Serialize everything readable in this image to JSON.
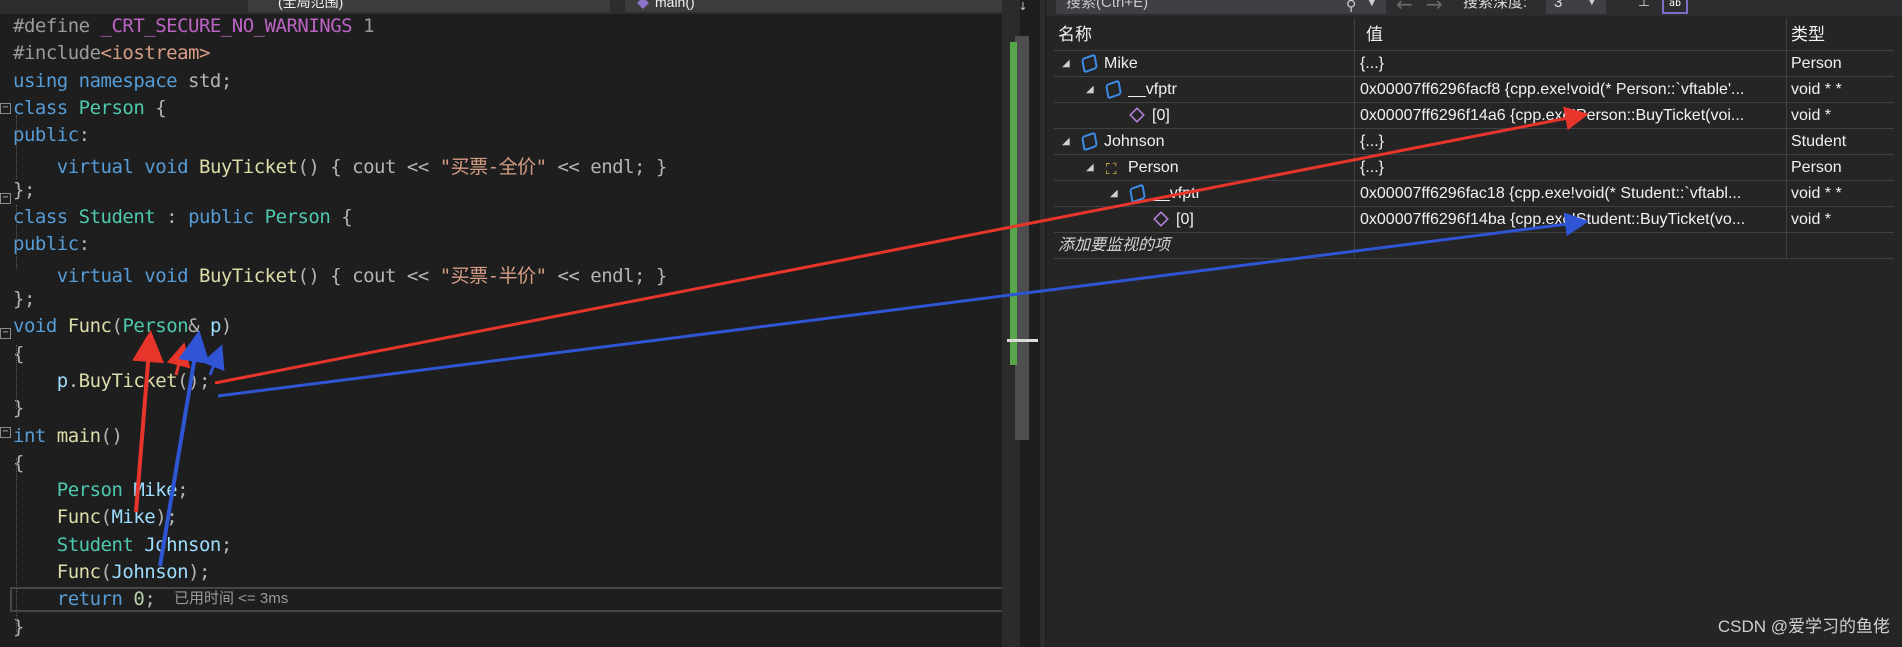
{
  "editor": {
    "tab_scope": "(全局范围)",
    "tab_function": "main()",
    "elapsed": "已用时间 <= 3ms"
  },
  "code": [
    {
      "tokens": [
        {
          "t": "#define ",
          "c": "pp"
        },
        {
          "t": "_CRT_SECURE_NO_WARNINGS",
          "c": "macro"
        },
        {
          "t": " 1",
          "c": "pp"
        }
      ]
    },
    {
      "tokens": [
        {
          "t": "#include",
          "c": "pp"
        },
        {
          "t": "<iostream>",
          "c": "str"
        }
      ]
    },
    {
      "tokens": [
        {
          "t": "using",
          "c": "kw"
        },
        {
          "t": " ",
          "c": "pun"
        },
        {
          "t": "namespace",
          "c": "kw"
        },
        {
          "t": " std;",
          "c": "pun"
        }
      ]
    },
    {
      "tokens": [
        {
          "t": "class",
          "c": "kw"
        },
        {
          "t": " ",
          "c": "pun"
        },
        {
          "t": "Person",
          "c": "type"
        },
        {
          "t": " {",
          "c": "pun"
        }
      ]
    },
    {
      "tokens": [
        {
          "t": "public",
          "c": "kw"
        },
        {
          "t": ":",
          "c": "pun"
        }
      ]
    },
    {
      "tokens": [
        {
          "t": "    ",
          "c": "pun"
        },
        {
          "t": "virtual",
          "c": "kw"
        },
        {
          "t": " ",
          "c": "pun"
        },
        {
          "t": "void",
          "c": "kw"
        },
        {
          "t": " ",
          "c": "pun"
        },
        {
          "t": "BuyTicket",
          "c": "fn"
        },
        {
          "t": "() { cout << ",
          "c": "pun"
        },
        {
          "t": "\"买票-全价\"",
          "c": "str"
        },
        {
          "t": " << endl; }",
          "c": "pun"
        }
      ]
    },
    {
      "tokens": [
        {
          "t": "};",
          "c": "pun"
        }
      ]
    },
    {
      "tokens": [
        {
          "t": "class",
          "c": "kw"
        },
        {
          "t": " ",
          "c": "pun"
        },
        {
          "t": "Student",
          "c": "type"
        },
        {
          "t": " : ",
          "c": "pun"
        },
        {
          "t": "public",
          "c": "kw"
        },
        {
          "t": " ",
          "c": "pun"
        },
        {
          "t": "Person",
          "c": "type"
        },
        {
          "t": " {",
          "c": "pun"
        }
      ]
    },
    {
      "tokens": [
        {
          "t": "public",
          "c": "kw"
        },
        {
          "t": ":",
          "c": "pun"
        }
      ]
    },
    {
      "tokens": [
        {
          "t": "    ",
          "c": "pun"
        },
        {
          "t": "virtual",
          "c": "kw"
        },
        {
          "t": " ",
          "c": "pun"
        },
        {
          "t": "void",
          "c": "kw"
        },
        {
          "t": " ",
          "c": "pun"
        },
        {
          "t": "BuyTicket",
          "c": "fn"
        },
        {
          "t": "() { cout << ",
          "c": "pun"
        },
        {
          "t": "\"买票-半价\"",
          "c": "str"
        },
        {
          "t": " << endl; }",
          "c": "pun"
        }
      ]
    },
    {
      "tokens": [
        {
          "t": "};",
          "c": "pun"
        }
      ]
    },
    {
      "tokens": [
        {
          "t": "void",
          "c": "kw"
        },
        {
          "t": " ",
          "c": "pun"
        },
        {
          "t": "Func",
          "c": "fn"
        },
        {
          "t": "(",
          "c": "pun"
        },
        {
          "t": "Person",
          "c": "type"
        },
        {
          "t": "& ",
          "c": "pun"
        },
        {
          "t": "p",
          "c": "var"
        },
        {
          "t": ")",
          "c": "pun"
        }
      ]
    },
    {
      "tokens": [
        {
          "t": "{",
          "c": "pun"
        }
      ]
    },
    {
      "tokens": [
        {
          "t": "    ",
          "c": "pun"
        },
        {
          "t": "p",
          "c": "var"
        },
        {
          "t": ".",
          "c": "pun"
        },
        {
          "t": "BuyTicket",
          "c": "fn"
        },
        {
          "t": "();",
          "c": "pun"
        }
      ]
    },
    {
      "tokens": [
        {
          "t": "}",
          "c": "pun"
        }
      ]
    },
    {
      "tokens": [
        {
          "t": "int",
          "c": "kw"
        },
        {
          "t": " ",
          "c": "pun"
        },
        {
          "t": "main",
          "c": "fn"
        },
        {
          "t": "()",
          "c": "pun"
        }
      ]
    },
    {
      "tokens": [
        {
          "t": "{",
          "c": "pun"
        }
      ]
    },
    {
      "tokens": [
        {
          "t": "    ",
          "c": "pun"
        },
        {
          "t": "Person",
          "c": "type"
        },
        {
          "t": " ",
          "c": "pun"
        },
        {
          "t": "Mike",
          "c": "var"
        },
        {
          "t": ";",
          "c": "pun"
        }
      ]
    },
    {
      "tokens": [
        {
          "t": "    ",
          "c": "pun"
        },
        {
          "t": "Func",
          "c": "fn"
        },
        {
          "t": "(",
          "c": "pun"
        },
        {
          "t": "Mike",
          "c": "var"
        },
        {
          "t": ");",
          "c": "pun"
        }
      ]
    },
    {
      "tokens": [
        {
          "t": "    ",
          "c": "pun"
        },
        {
          "t": "Student",
          "c": "type"
        },
        {
          "t": " ",
          "c": "pun"
        },
        {
          "t": "Johnson",
          "c": "var"
        },
        {
          "t": ";",
          "c": "pun"
        }
      ]
    },
    {
      "tokens": [
        {
          "t": "    ",
          "c": "pun"
        },
        {
          "t": "Func",
          "c": "fn"
        },
        {
          "t": "(",
          "c": "pun"
        },
        {
          "t": "Johnson",
          "c": "var"
        },
        {
          "t": ");",
          "c": "pun"
        }
      ]
    },
    {
      "tokens": [
        {
          "t": "    ",
          "c": "pun"
        },
        {
          "t": "return",
          "c": "kw"
        },
        {
          "t": " ",
          "c": "pun"
        },
        {
          "t": "0",
          "c": "num"
        },
        {
          "t": ";",
          "c": "pun"
        }
      ]
    },
    {
      "tokens": [
        {
          "t": "}",
          "c": "pun"
        }
      ]
    }
  ],
  "watch": {
    "search_placeholder": "搜索(Ctrl+E)",
    "depth_label": "搜索深度:",
    "depth_value": "3",
    "hex_label": "ab",
    "columns": {
      "name": "名称",
      "value": "值",
      "type": "类型"
    },
    "rows": [
      {
        "name": "Mike",
        "value": "{...}",
        "type": "Person",
        "icon": "object-icon"
      },
      {
        "name": "__vfptr",
        "value": "0x00007ff6296facf8 {cpp.exe!void(* Person::`vftable'...",
        "type": "void * *",
        "icon": "object-icon"
      },
      {
        "name": "[0]",
        "value": "0x00007ff6296f14a6 {cpp.exe!Person::BuyTicket(voi...",
        "type": "void *",
        "icon": "field-icon"
      },
      {
        "name": "Johnson",
        "value": "{...}",
        "type": "Student",
        "icon": "object-icon"
      },
      {
        "name": "Person",
        "value": "{...}",
        "type": "Person",
        "icon": "base-class-icon"
      },
      {
        "name": "__vfptr",
        "value": "0x00007ff6296fac18 {cpp.exe!void(* Student::`vftabl...",
        "type": "void * *",
        "icon": "object-icon"
      },
      {
        "name": "[0]",
        "value": "0x00007ff6296f14ba {cpp.exe!Student::BuyTicket(vo...",
        "type": "void *",
        "icon": "field-icon"
      }
    ],
    "add_item": "添加要监视的项"
  },
  "watermark": "CSDN @爱学习的鱼佬",
  "annotation_colors": {
    "red": "#e8352b",
    "blue": "#2f55d4"
  }
}
